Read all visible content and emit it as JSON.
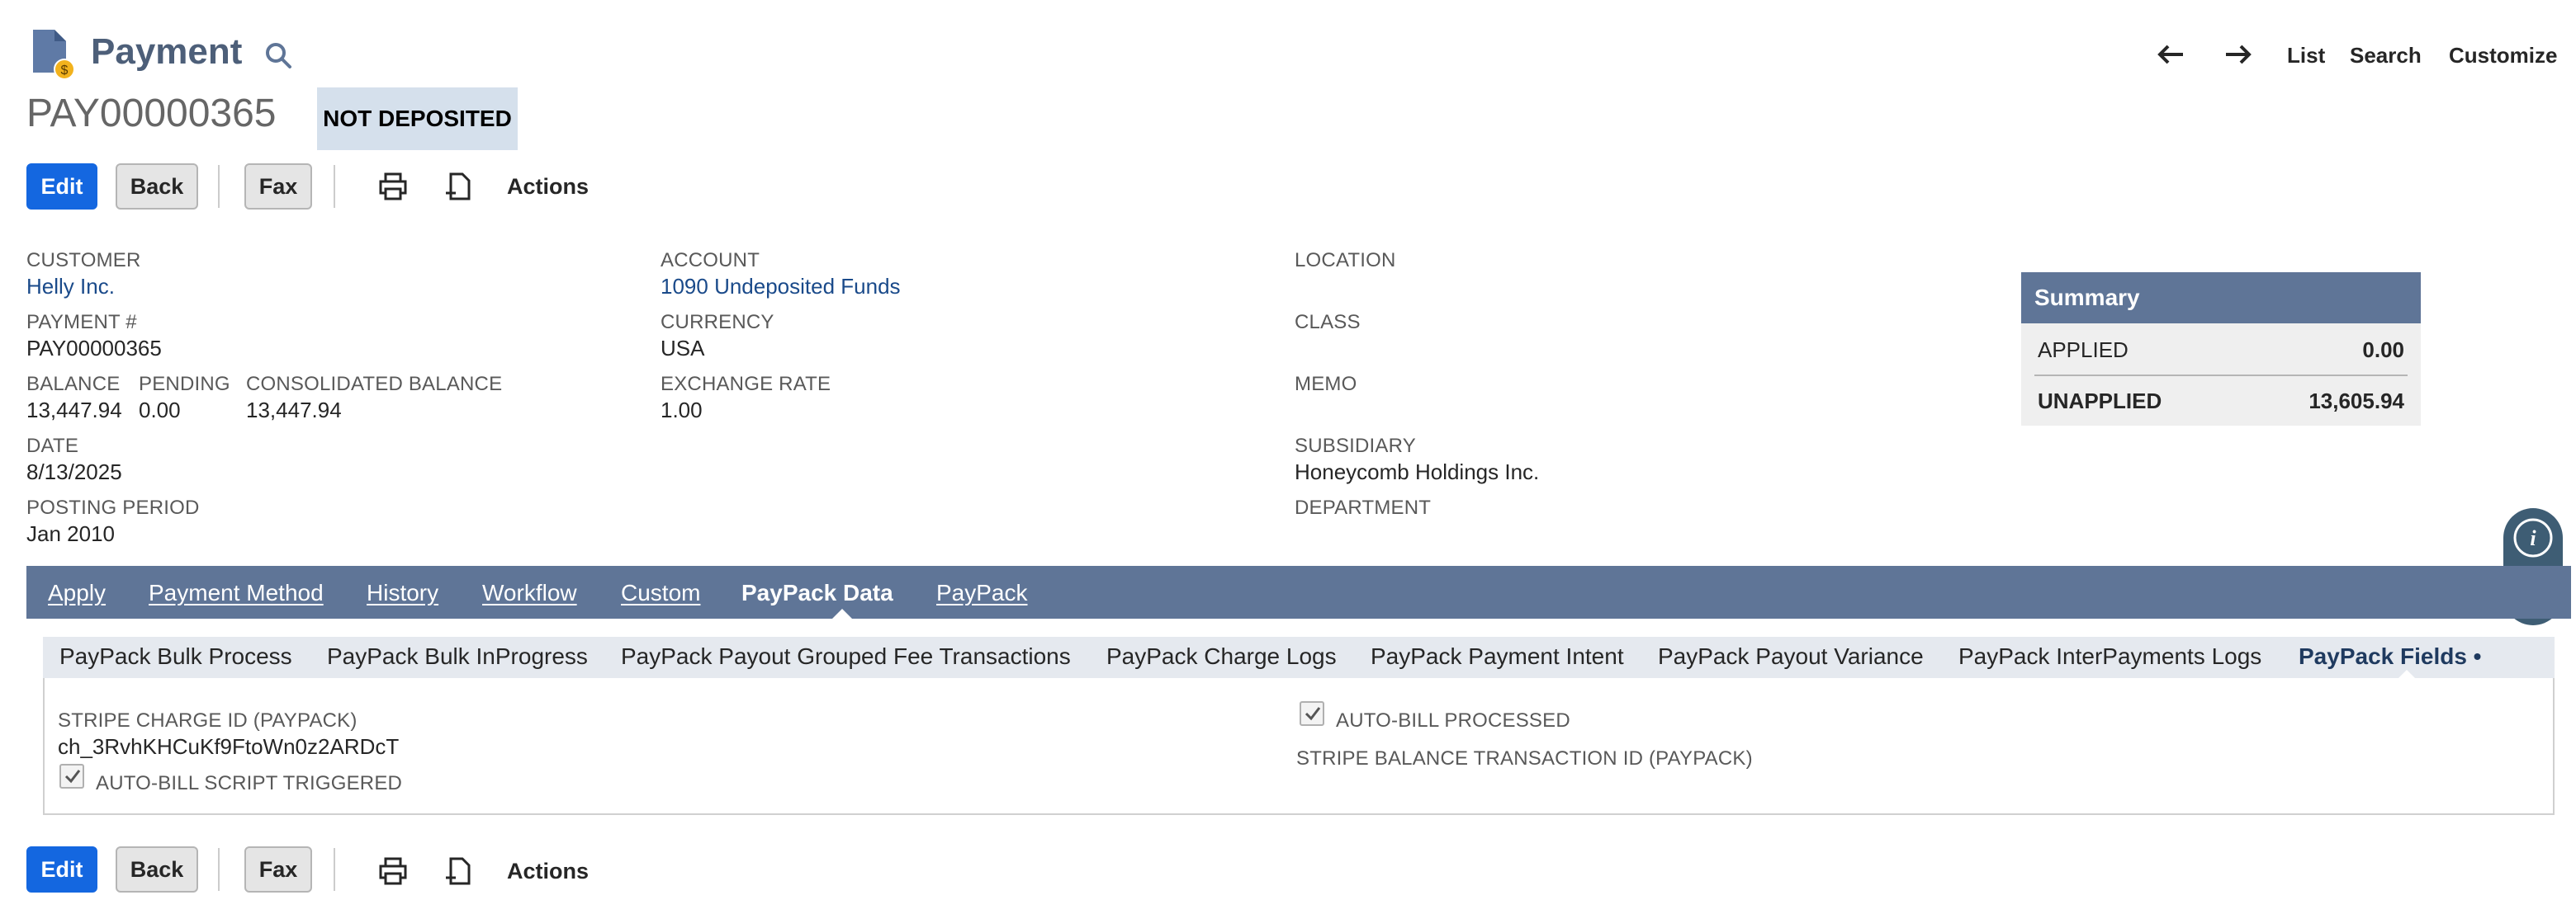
{
  "header": {
    "title": "Payment",
    "record_id": "PAY00000365",
    "status": "NOT DEPOSITED",
    "nav": {
      "list": "List",
      "search": "Search",
      "customize": "Customize"
    }
  },
  "toolbar": {
    "edit": "Edit",
    "back": "Back",
    "fax": "Fax",
    "actions": "Actions"
  },
  "fields": {
    "customer_label": "CUSTOMER",
    "customer_value": "Helly Inc.",
    "payment_no_label": "PAYMENT #",
    "payment_no_value": "PAY00000365",
    "balance_label": "BALANCE",
    "balance_value": "13,447.94",
    "pending_label": "PENDING",
    "pending_value": "0.00",
    "consolidated_label": "CONSOLIDATED BALANCE",
    "consolidated_value": "13,447.94",
    "date_label": "DATE",
    "date_value": "8/13/2025",
    "posting_period_label": "POSTING PERIOD",
    "posting_period_value": "Jan 2010",
    "account_label": "ACCOUNT",
    "account_value": "1090 Undeposited Funds",
    "currency_label": "CURRENCY",
    "currency_value": "USA",
    "exchange_rate_label": "EXCHANGE RATE",
    "exchange_rate_value": "1.00",
    "location_label": "LOCATION",
    "class_label": "CLASS",
    "memo_label": "MEMO",
    "subsidiary_label": "SUBSIDIARY",
    "subsidiary_value": "Honeycomb Holdings Inc.",
    "department_label": "DEPARTMENT"
  },
  "summary": {
    "title": "Summary",
    "applied_label": "APPLIED",
    "applied_value": "0.00",
    "unapplied_label": "UNAPPLIED",
    "unapplied_value": "13,605.94"
  },
  "main_tabs": [
    {
      "label": "Apply"
    },
    {
      "label": "Payment Method"
    },
    {
      "label": "History"
    },
    {
      "label": "Workflow"
    },
    {
      "label": "Custom"
    },
    {
      "label": "PayPack Data"
    },
    {
      "label": "PayPack"
    }
  ],
  "sub_tabs": [
    {
      "label": "PayPack Bulk Process"
    },
    {
      "label": "PayPack Bulk InProgress"
    },
    {
      "label": "PayPack Payout Grouped Fee Transactions"
    },
    {
      "label": "PayPack Charge Logs"
    },
    {
      "label": "PayPack Payment Intent"
    },
    {
      "label": "PayPack Payout Variance"
    },
    {
      "label": "PayPack InterPayments Logs"
    },
    {
      "label": "PayPack Fields •"
    }
  ],
  "paypack_fields": {
    "stripe_charge_label": "STRIPE CHARGE ID (PAYPACK)",
    "stripe_charge_value": "ch_3RvhKHCuKf9FtoWn0z2ARDcT",
    "autobill_script_label": "AUTO-BILL SCRIPT TRIGGERED",
    "autobill_processed_label": "AUTO-BILL PROCESSED",
    "stripe_balance_label": "STRIPE BALANCE TRANSACTION ID (PAYPACK)"
  },
  "colors": {
    "primary_button": "#1467e0",
    "tab_bar": "#5f7597",
    "title": "#4d5f79",
    "link": "#1a4a8a"
  }
}
